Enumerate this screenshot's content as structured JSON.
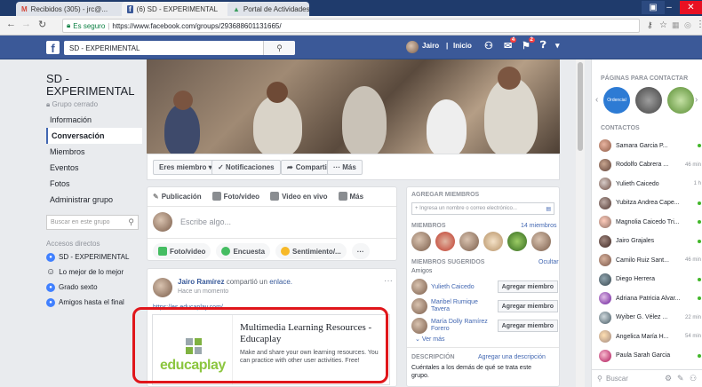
{
  "browser": {
    "tabs": [
      {
        "label": "Recibidos (305) - jrc@..."
      },
      {
        "label": "(6) SD - EXPERIMENTAL"
      },
      {
        "label": "Portal de Actividades Ed..."
      }
    ],
    "secure_label": "Es seguro",
    "url": "https://www.facebook.com/groups/293688601131665/"
  },
  "fb": {
    "logo": "f",
    "search_value": "SD - EXPERIMENTAL",
    "user_name": "Jairo",
    "home_label": "Inicio",
    "badge_messages": "4",
    "badge_notifications": "2"
  },
  "group": {
    "name": "SD - EXPERIMENTAL",
    "privacy": "Grupo cerrado",
    "nav": [
      "Información",
      "Conversación",
      "Miembros",
      "Eventos",
      "Fotos",
      "Administrar grupo"
    ],
    "search_placeholder": "Buscar en este grupo",
    "shortcuts_title": "Accesos directos",
    "shortcuts": [
      "SD - EXPERIMENTAL",
      "Lo mejor de lo mejor",
      "Grado sexto",
      "Amigos hasta el final"
    ]
  },
  "actions": {
    "member": "Eres miembro ▾",
    "notifications": "✓ Notificaciones",
    "share": "Compartir",
    "more": "··· Más"
  },
  "composer": {
    "tabs": [
      "Publicación",
      "Foto/video",
      "Video en vivo",
      "Más"
    ],
    "placeholder": "Escribe algo...",
    "pills": [
      "Foto/video",
      "Encuesta",
      "Sentimiento/...",
      "···"
    ]
  },
  "post": {
    "author": "Jairo Ramírez",
    "action": "compartió un",
    "action_link": "enlace.",
    "time": "Hace un momento",
    "url": "https://es.educaplay.com/",
    "link_title": "Multimedia Learning Resources - Educaplay",
    "link_desc": "Make and share your own learning resources. You can practice with other user activities. Free!",
    "brand": "educaplay"
  },
  "members_panel": {
    "add_title": "AGREGAR MIEMBROS",
    "add_placeholder": "+ Ingresa un nombre o correo electrónico...",
    "members_title": "MIEMBROS",
    "members_count": "14 miembros",
    "suggested_title": "MIEMBROS SUGERIDOS",
    "hide": "Ocultar",
    "friends_label": "Amigos",
    "suggested": [
      {
        "name": "Yulieth Caicedo"
      },
      {
        "name": "Maribel Rumique Tavera"
      },
      {
        "name": "María Dolly Ramírez Forero"
      }
    ],
    "add_button": "Agregar miembro",
    "see_more": "Ver más",
    "desc_title": "DESCRIPCIÓN",
    "desc_link": "Agregar una descripción",
    "desc_text": "Cuéntales a los demás de qué se trata este grupo."
  },
  "chat": {
    "pages_title": "PÁGINAS PARA CONTACTAR",
    "contacts_title": "CONTACTOS",
    "contacts": [
      {
        "name": "Samara Garcia P...",
        "time": ""
      },
      {
        "name": "Rodolfo Cabrera ...",
        "time": "46 min"
      },
      {
        "name": "Yulieth Caicedo",
        "time": "1 h"
      },
      {
        "name": "Yubitza Andrea Cape...",
        "time": ""
      },
      {
        "name": "Magnolia Caicedo Tri...",
        "time": ""
      },
      {
        "name": "Jairo Grajales",
        "time": ""
      },
      {
        "name": "Camilo Ruiz Sant...",
        "time": "46 min"
      },
      {
        "name": "Diego Herrera",
        "time": ""
      },
      {
        "name": "Adriana Patricia Alvar...",
        "time": ""
      },
      {
        "name": "Wyiber G. Vélez ...",
        "time": "22 min"
      },
      {
        "name": "Angelica María H...",
        "time": "54 min"
      },
      {
        "name": "Paula Sarah Garcia",
        "time": ""
      }
    ],
    "search_placeholder": "Buscar"
  },
  "colors": {
    "fb_blue": "#3b5998",
    "highlight_red": "#e0161b"
  }
}
